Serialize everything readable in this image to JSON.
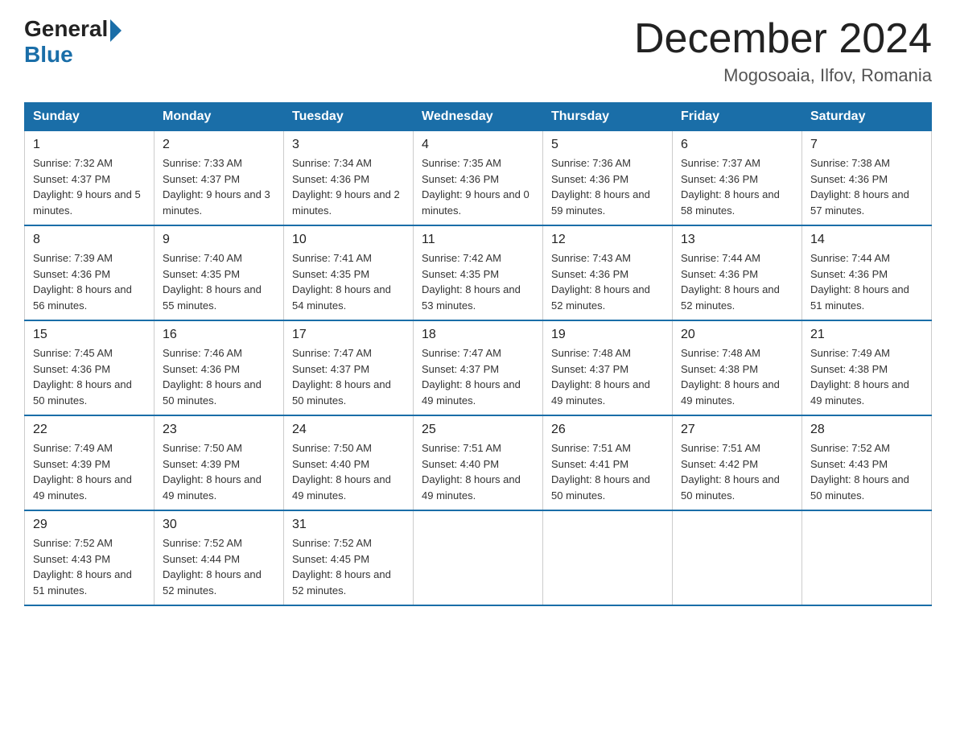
{
  "logo": {
    "general": "General",
    "blue": "Blue"
  },
  "title": "December 2024",
  "subtitle": "Mogosoaia, Ilfov, Romania",
  "days_header": [
    "Sunday",
    "Monday",
    "Tuesday",
    "Wednesday",
    "Thursday",
    "Friday",
    "Saturday"
  ],
  "weeks": [
    [
      {
        "day": "1",
        "sunrise": "7:32 AM",
        "sunset": "4:37 PM",
        "daylight": "9 hours and 5 minutes."
      },
      {
        "day": "2",
        "sunrise": "7:33 AM",
        "sunset": "4:37 PM",
        "daylight": "9 hours and 3 minutes."
      },
      {
        "day": "3",
        "sunrise": "7:34 AM",
        "sunset": "4:36 PM",
        "daylight": "9 hours and 2 minutes."
      },
      {
        "day": "4",
        "sunrise": "7:35 AM",
        "sunset": "4:36 PM",
        "daylight": "9 hours and 0 minutes."
      },
      {
        "day": "5",
        "sunrise": "7:36 AM",
        "sunset": "4:36 PM",
        "daylight": "8 hours and 59 minutes."
      },
      {
        "day": "6",
        "sunrise": "7:37 AM",
        "sunset": "4:36 PM",
        "daylight": "8 hours and 58 minutes."
      },
      {
        "day": "7",
        "sunrise": "7:38 AM",
        "sunset": "4:36 PM",
        "daylight": "8 hours and 57 minutes."
      }
    ],
    [
      {
        "day": "8",
        "sunrise": "7:39 AM",
        "sunset": "4:36 PM",
        "daylight": "8 hours and 56 minutes."
      },
      {
        "day": "9",
        "sunrise": "7:40 AM",
        "sunset": "4:35 PM",
        "daylight": "8 hours and 55 minutes."
      },
      {
        "day": "10",
        "sunrise": "7:41 AM",
        "sunset": "4:35 PM",
        "daylight": "8 hours and 54 minutes."
      },
      {
        "day": "11",
        "sunrise": "7:42 AM",
        "sunset": "4:35 PM",
        "daylight": "8 hours and 53 minutes."
      },
      {
        "day": "12",
        "sunrise": "7:43 AM",
        "sunset": "4:36 PM",
        "daylight": "8 hours and 52 minutes."
      },
      {
        "day": "13",
        "sunrise": "7:44 AM",
        "sunset": "4:36 PM",
        "daylight": "8 hours and 52 minutes."
      },
      {
        "day": "14",
        "sunrise": "7:44 AM",
        "sunset": "4:36 PM",
        "daylight": "8 hours and 51 minutes."
      }
    ],
    [
      {
        "day": "15",
        "sunrise": "7:45 AM",
        "sunset": "4:36 PM",
        "daylight": "8 hours and 50 minutes."
      },
      {
        "day": "16",
        "sunrise": "7:46 AM",
        "sunset": "4:36 PM",
        "daylight": "8 hours and 50 minutes."
      },
      {
        "day": "17",
        "sunrise": "7:47 AM",
        "sunset": "4:37 PM",
        "daylight": "8 hours and 50 minutes."
      },
      {
        "day": "18",
        "sunrise": "7:47 AM",
        "sunset": "4:37 PM",
        "daylight": "8 hours and 49 minutes."
      },
      {
        "day": "19",
        "sunrise": "7:48 AM",
        "sunset": "4:37 PM",
        "daylight": "8 hours and 49 minutes."
      },
      {
        "day": "20",
        "sunrise": "7:48 AM",
        "sunset": "4:38 PM",
        "daylight": "8 hours and 49 minutes."
      },
      {
        "day": "21",
        "sunrise": "7:49 AM",
        "sunset": "4:38 PM",
        "daylight": "8 hours and 49 minutes."
      }
    ],
    [
      {
        "day": "22",
        "sunrise": "7:49 AM",
        "sunset": "4:39 PM",
        "daylight": "8 hours and 49 minutes."
      },
      {
        "day": "23",
        "sunrise": "7:50 AM",
        "sunset": "4:39 PM",
        "daylight": "8 hours and 49 minutes."
      },
      {
        "day": "24",
        "sunrise": "7:50 AM",
        "sunset": "4:40 PM",
        "daylight": "8 hours and 49 minutes."
      },
      {
        "day": "25",
        "sunrise": "7:51 AM",
        "sunset": "4:40 PM",
        "daylight": "8 hours and 49 minutes."
      },
      {
        "day": "26",
        "sunrise": "7:51 AM",
        "sunset": "4:41 PM",
        "daylight": "8 hours and 50 minutes."
      },
      {
        "day": "27",
        "sunrise": "7:51 AM",
        "sunset": "4:42 PM",
        "daylight": "8 hours and 50 minutes."
      },
      {
        "day": "28",
        "sunrise": "7:52 AM",
        "sunset": "4:43 PM",
        "daylight": "8 hours and 50 minutes."
      }
    ],
    [
      {
        "day": "29",
        "sunrise": "7:52 AM",
        "sunset": "4:43 PM",
        "daylight": "8 hours and 51 minutes."
      },
      {
        "day": "30",
        "sunrise": "7:52 AM",
        "sunset": "4:44 PM",
        "daylight": "8 hours and 52 minutes."
      },
      {
        "day": "31",
        "sunrise": "7:52 AM",
        "sunset": "4:45 PM",
        "daylight": "8 hours and 52 minutes."
      },
      null,
      null,
      null,
      null
    ]
  ]
}
